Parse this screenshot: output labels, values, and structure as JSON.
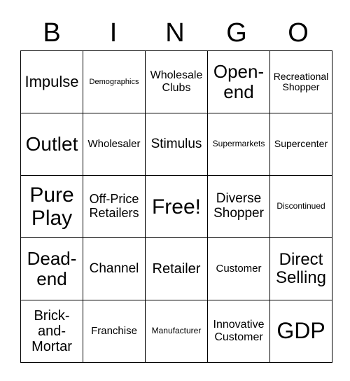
{
  "header": [
    "B",
    "I",
    "N",
    "G",
    "O"
  ],
  "cells": [
    [
      [
        "Impulse",
        22
      ],
      [
        "Demographics",
        11
      ],
      [
        "Wholesale Clubs",
        16
      ],
      [
        "Open-end",
        26
      ],
      [
        "Recreational Shopper",
        14
      ]
    ],
    [
      [
        "Outlet",
        28
      ],
      [
        "Wholesaler",
        15
      ],
      [
        "Stimulus",
        19
      ],
      [
        "Supermarkets",
        12
      ],
      [
        "Supercenter",
        14
      ]
    ],
    [
      [
        "Pure Play",
        30
      ],
      [
        "Off-Price Retailers",
        18
      ],
      [
        "Free!",
        30
      ],
      [
        "Diverse Shopper",
        19
      ],
      [
        "Discontinued",
        12
      ]
    ],
    [
      [
        "Dead-end",
        26
      ],
      [
        "Channel",
        19
      ],
      [
        "Retailer",
        20
      ],
      [
        "Customer",
        15
      ],
      [
        "Direct Selling",
        24
      ]
    ],
    [
      [
        "Brick-and-Mortar",
        20
      ],
      [
        "Franchise",
        15
      ],
      [
        "Manufacturer",
        12
      ],
      [
        "Innovative Customer",
        16
      ],
      [
        "GDP",
        32
      ]
    ]
  ]
}
